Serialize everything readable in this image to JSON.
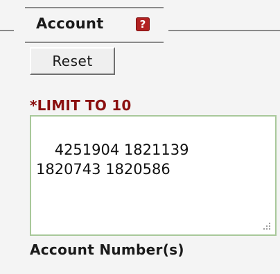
{
  "fieldset": {
    "legend": "Account",
    "help_icon_glyph": "?",
    "help_icon": "help-icon",
    "help_icon_color": "#b22222"
  },
  "reset_button": {
    "label": "Reset"
  },
  "limit_note": {
    "text": "*LIMIT TO 10",
    "color": "#8b1010"
  },
  "account_numbers": {
    "value": "4251904 1821139\n1820743 1820586",
    "border_color": "#a8c89a"
  },
  "field_label": "Account Number(s)"
}
